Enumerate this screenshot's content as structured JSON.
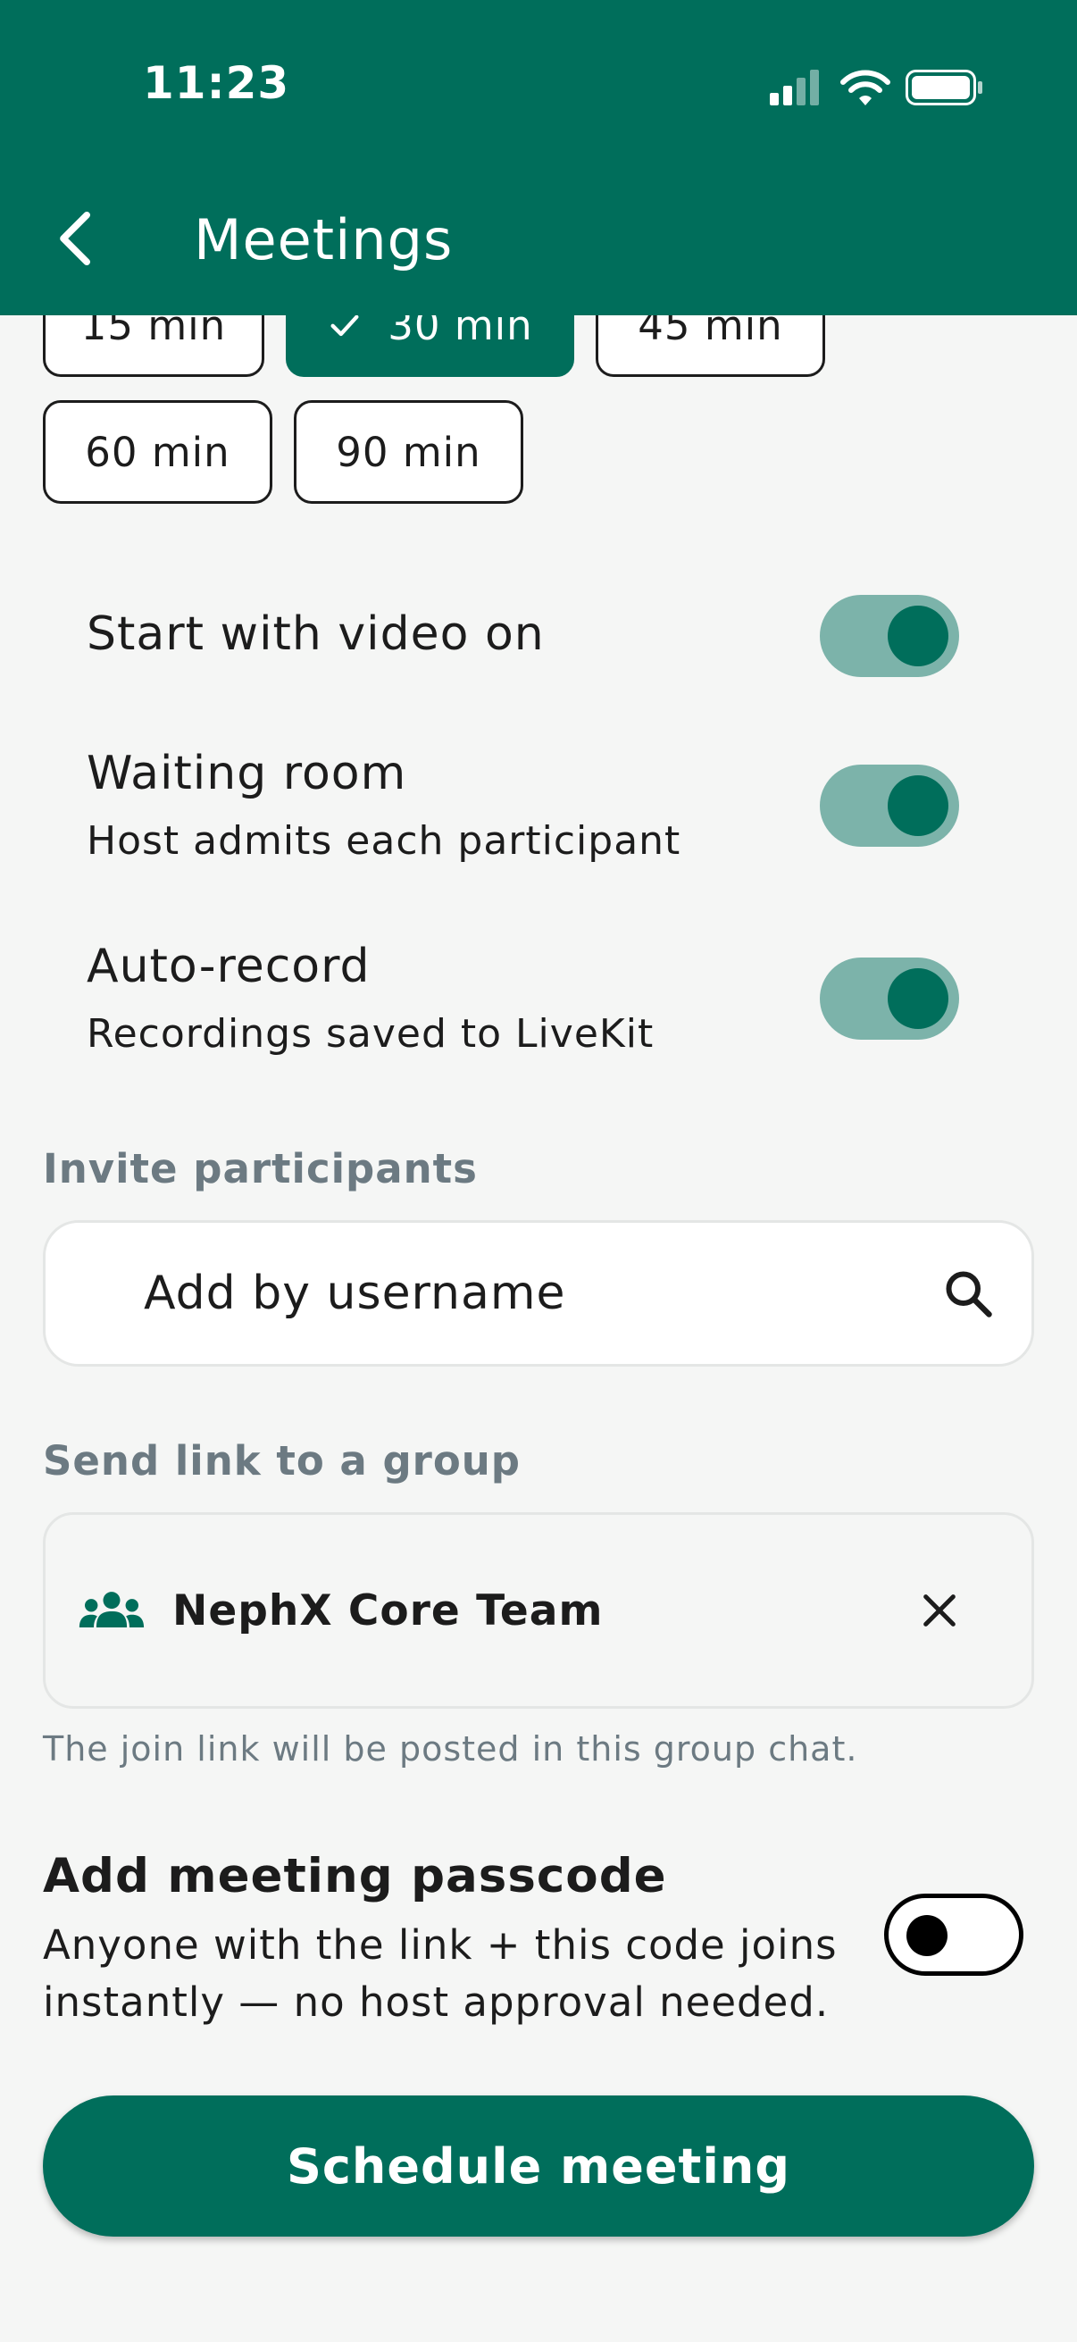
{
  "status_bar": {
    "time": "11:23",
    "icons": [
      "signal-icon",
      "wifi-icon",
      "battery-icon"
    ]
  },
  "appbar": {
    "title": "Meetings",
    "back_icon": "chevron-left-icon"
  },
  "durations": {
    "options": [
      "15 min",
      "30 min",
      "45 min",
      "60 min",
      "90 min"
    ],
    "selected": "30 min"
  },
  "settings": [
    {
      "title": "Start with video on",
      "subtitle": "",
      "enabled": true
    },
    {
      "title": "Waiting room",
      "subtitle": "Host admits each participant",
      "enabled": true
    },
    {
      "title": "Auto-record",
      "subtitle": "Recordings saved to LiveKit",
      "enabled": true
    }
  ],
  "invite": {
    "label": "Invite participants",
    "placeholder": "Add by username"
  },
  "group": {
    "label": "Send link to a group",
    "selected_name": "NephX Core Team",
    "hint": "The join link will be posted in this group chat."
  },
  "passcode": {
    "title": "Add meeting passcode",
    "description": "Anyone with the link + this code joins instantly — no host approval needed.",
    "enabled": false
  },
  "actions": {
    "schedule_label": "Schedule meeting"
  },
  "colors": {
    "primary": "#006e5b",
    "switch_track": "#7cb3aa",
    "muted_label": "#6c7a82",
    "background": "#f5f6f5"
  }
}
